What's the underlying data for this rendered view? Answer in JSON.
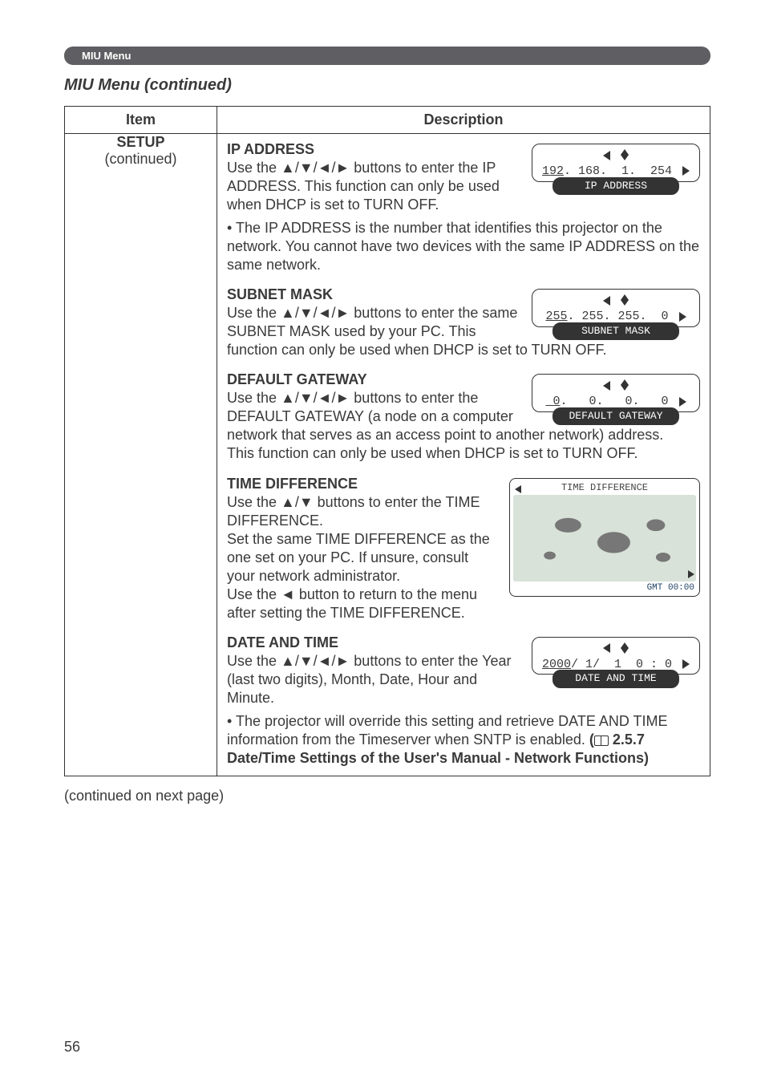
{
  "section_tag": "MIU Menu",
  "page_title": "MIU Menu (continued)",
  "headers": {
    "item": "Item",
    "description": "Description"
  },
  "item_cell": {
    "title": "SETUP",
    "sub": "(continued)"
  },
  "blocks": {
    "ip": {
      "heading": "IP ADDRESS",
      "body": "Use the ▲/▼/◄/► buttons to enter the IP ADDRESS. This function can only be used when DHCP is set to TURN OFF.",
      "note": "• The IP ADDRESS is the number that identifies this projector on the network. You cannot have two devices with the same IP ADDRESS on the same network.",
      "pill_value": "192. 168.  1.  254",
      "pill_label": "IP ADDRESS"
    },
    "subnet": {
      "heading": "SUBNET MASK",
      "body": "Use the ▲/▼/◄/► buttons to enter the same SUBNET MASK used by your PC. This function can only be used when DHCP is set to TURN OFF.",
      "pill_value": "255. 255. 255.  0",
      "pill_label": "SUBNET MASK"
    },
    "gateway": {
      "heading": "DEFAULT GATEWAY",
      "body": "Use the ▲/▼/◄/► buttons to enter the DEFAULT GATEWAY (a node on a computer network that serves as an access point to another network) address.\nThis function can only be used when DHCP is set to TURN OFF.",
      "pill_value": "0.   0.   0.   0",
      "pill_label": "DEFAULT GATEWAY"
    },
    "timediff": {
      "heading": "TIME DIFFERENCE",
      "body": "Use the ▲/▼ buttons to enter the TIME DIFFERENCE.\nSet the same TIME DIFFERENCE as the one set on your PC. If unsure, consult your network administrator.\nUse the ◄ button to return to the menu after setting the TIME DIFFERENCE.",
      "map_title": "TIME DIFFERENCE",
      "map_gmt": "GMT 00:00"
    },
    "datetime": {
      "heading": "DATE AND TIME",
      "body": "Use the ▲/▼/◄/► buttons to enter the Year (last two digits), Month, Date, Hour and Minute.",
      "note_prefix": "• The projector will override this setting and retrieve DATE AND TIME information from the Timeserver when SNTP is enabled. ",
      "note_ref": "2.5.7 Date/Time Settings of the User's Manual - Network Functions)",
      "pill_value": "2000/ 1/  1  0 : 0",
      "pill_label": "DATE AND TIME"
    }
  },
  "continued": "(continued on next page)",
  "page_number": "56"
}
